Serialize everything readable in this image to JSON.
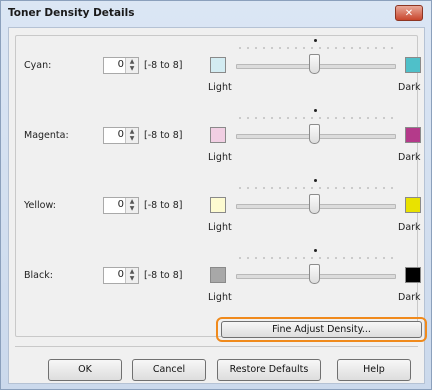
{
  "window": {
    "title": "Toner Density Details",
    "close_glyph": "✕"
  },
  "range_text": "[-8 to 8]",
  "light_label": "Light",
  "dark_label": "Dark",
  "channels": [
    {
      "label": "Cyan:",
      "value": "0",
      "light_color": "#d3ecf2",
      "dark_color": "#4fc0c9",
      "slider_value": 0
    },
    {
      "label": "Magenta:",
      "value": "0",
      "light_color": "#f1cfe3",
      "dark_color": "#b43a8a",
      "slider_value": 0
    },
    {
      "label": "Yellow:",
      "value": "0",
      "light_color": "#fdfbd1",
      "dark_color": "#e9e200",
      "slider_value": 0
    },
    {
      "label": "Black:",
      "value": "0",
      "light_color": "#a8a8a8",
      "dark_color": "#000000",
      "slider_value": 0
    }
  ],
  "buttons": {
    "fine_adjust": "Fine Adjust Density...",
    "ok": "OK",
    "cancel": "Cancel",
    "restore": "Restore Defaults",
    "help": "Help"
  },
  "colors": {
    "highlight": "#f08a1c"
  }
}
